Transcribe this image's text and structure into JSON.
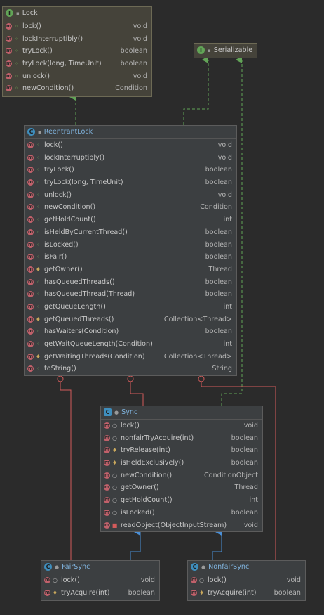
{
  "colors": {
    "background": "#2b2b2b",
    "interface_fill": "#45433a",
    "class_fill": "#3c3f41",
    "realization_edge": "#62a457",
    "inheritance_edge": "#4a8fd6",
    "inner_class_edge": "#d35b5b"
  },
  "lock": {
    "title": "Lock",
    "icon": "interface-icon",
    "methods": [
      {
        "name": "lock()",
        "type": "void"
      },
      {
        "name": "lockInterruptibly()",
        "type": "void"
      },
      {
        "name": "tryLock()",
        "type": "boolean"
      },
      {
        "name": "tryLock(long, TimeUnit)",
        "type": "boolean"
      },
      {
        "name": "unlock()",
        "type": "void"
      },
      {
        "name": "newCondition()",
        "type": "Condition"
      }
    ]
  },
  "serializable": {
    "title": "Serializable",
    "icon": "interface-icon"
  },
  "reentrant_lock": {
    "title": "ReentrantLock",
    "icon": "class-icon",
    "methods": [
      {
        "name": "lock()",
        "type": "void"
      },
      {
        "name": "lockInterruptibly()",
        "type": "void"
      },
      {
        "name": "tryLock()",
        "type": "boolean"
      },
      {
        "name": "tryLock(long, TimeUnit)",
        "type": "boolean"
      },
      {
        "name": "unlock()",
        "type": "void"
      },
      {
        "name": "newCondition()",
        "type": "Condition"
      },
      {
        "name": "getHoldCount()",
        "type": "int"
      },
      {
        "name": "isHeldByCurrentThread()",
        "type": "boolean"
      },
      {
        "name": "isLocked()",
        "type": "boolean"
      },
      {
        "name": "isFair()",
        "type": "boolean"
      },
      {
        "name": "getOwner()",
        "type": "Thread",
        "vis": "prot"
      },
      {
        "name": "hasQueuedThreads()",
        "type": "boolean"
      },
      {
        "name": "hasQueuedThread(Thread)",
        "type": "boolean"
      },
      {
        "name": "getQueueLength()",
        "type": "int"
      },
      {
        "name": "getQueuedThreads()",
        "type": "Collection<Thread>",
        "vis": "prot"
      },
      {
        "name": "hasWaiters(Condition)",
        "type": "boolean"
      },
      {
        "name": "getWaitQueueLength(Condition)",
        "type": "int"
      },
      {
        "name": "getWaitingThreads(Condition)",
        "type": "Collection<Thread>",
        "vis": "prot"
      },
      {
        "name": "toString()",
        "type": "String"
      }
    ]
  },
  "sync": {
    "title": "Sync",
    "icon": "abstract-class-icon",
    "methods": [
      {
        "name": "lock()",
        "type": "void",
        "vis": "pkg"
      },
      {
        "name": "nonfairTryAcquire(int)",
        "type": "boolean",
        "vis": "pkg"
      },
      {
        "name": "tryRelease(int)",
        "type": "boolean",
        "vis": "prot"
      },
      {
        "name": "isHeldExclusively()",
        "type": "boolean",
        "vis": "prot"
      },
      {
        "name": "newCondition()",
        "type": "ConditionObject",
        "vis": "pkg"
      },
      {
        "name": "getOwner()",
        "type": "Thread",
        "vis": "pkg"
      },
      {
        "name": "getHoldCount()",
        "type": "int",
        "vis": "pkg"
      },
      {
        "name": "isLocked()",
        "type": "boolean",
        "vis": "pkg"
      },
      {
        "name": "readObject(ObjectInputStream)",
        "type": "void",
        "vis": "priv"
      }
    ]
  },
  "fair_sync": {
    "title": "FairSync",
    "icon": "class-icon",
    "methods": [
      {
        "name": "lock()",
        "type": "void",
        "vis": "pkg"
      },
      {
        "name": "tryAcquire(int)",
        "type": "boolean",
        "vis": "prot"
      }
    ]
  },
  "nonfair_sync": {
    "title": "NonfairSync",
    "icon": "class-icon",
    "methods": [
      {
        "name": "lock()",
        "type": "void",
        "vis": "pkg"
      },
      {
        "name": "tryAcquire(int)",
        "type": "boolean",
        "vis": "prot"
      }
    ]
  }
}
